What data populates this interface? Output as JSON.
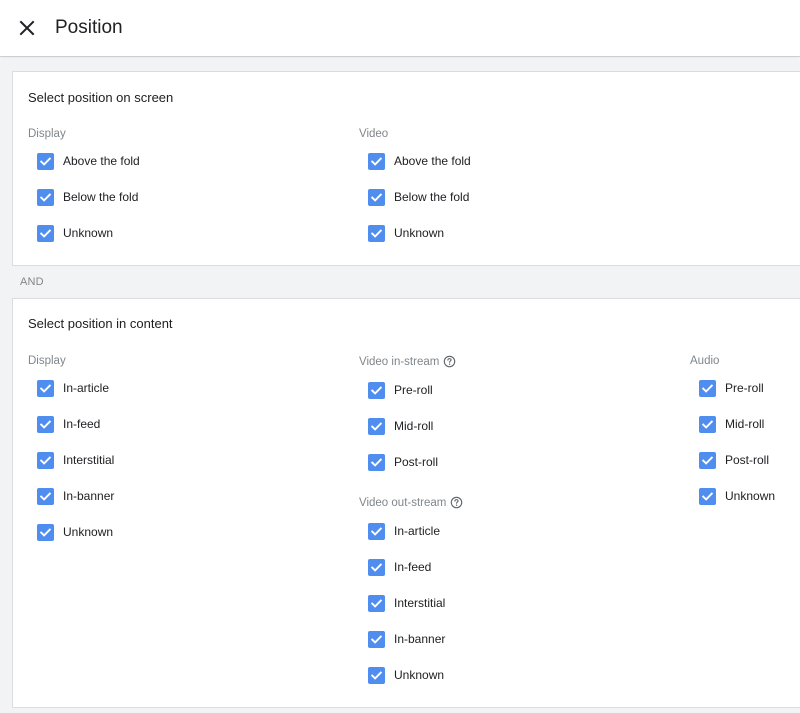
{
  "header": {
    "title": "Position"
  },
  "screen_section": {
    "title": "Select position on screen",
    "display": {
      "label": "Display",
      "items": [
        "Above the fold",
        "Below the fold",
        "Unknown"
      ]
    },
    "video": {
      "label": "Video",
      "items": [
        "Above the fold",
        "Below the fold",
        "Unknown"
      ]
    }
  },
  "and_label": "AND",
  "content_section": {
    "title": "Select position in content",
    "display": {
      "label": "Display",
      "items": [
        "In-article",
        "In-feed",
        "Interstitial",
        "In-banner",
        "Unknown"
      ]
    },
    "video_instream": {
      "label": "Video in-stream",
      "items": [
        "Pre-roll",
        "Mid-roll",
        "Post-roll"
      ]
    },
    "video_outstream": {
      "label": "Video out-stream",
      "items": [
        "In-article",
        "In-feed",
        "Interstitial",
        "In-banner",
        "Unknown"
      ]
    },
    "audio": {
      "label": "Audio",
      "items": [
        "Pre-roll",
        "Mid-roll",
        "Post-roll",
        "Unknown"
      ]
    }
  },
  "colors": {
    "checkbox": "#4f8def",
    "muted_text": "#80868b",
    "page_bg": "#f1f3f4"
  },
  "icons": {
    "close": "close-icon",
    "help": "help-circle-icon",
    "check": "check-icon"
  }
}
